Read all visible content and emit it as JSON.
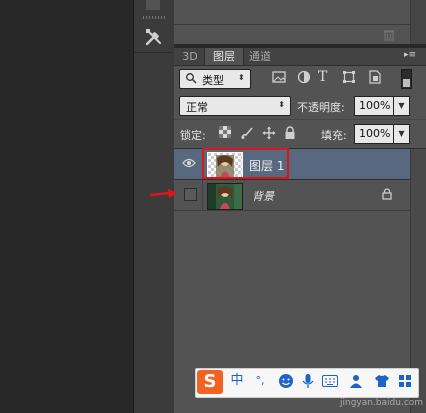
{
  "layers_panel": {
    "tabs": [
      "3D",
      "图层",
      "通道"
    ],
    "active_tab": "图层",
    "filter": {
      "label": "类型"
    },
    "blend_mode": "正常",
    "opacity": {
      "label": "不透明度:",
      "value": "100%"
    },
    "lock": {
      "label": "锁定:"
    },
    "fill": {
      "label": "填充:",
      "value": "100%"
    },
    "layers": [
      {
        "name": "图层 1",
        "visible": true,
        "selected": true
      },
      {
        "name": "背景",
        "visible": false,
        "selected": false,
        "locked": true
      }
    ]
  },
  "ime_toolbar": {
    "logo": "S",
    "mode": "中",
    "punct": "°,"
  },
  "watermark": "jingyan.baidu.com",
  "colors": {
    "highlight": "#e0151b",
    "selected_row": "#57687f",
    "ime_logo": "#f06322"
  },
  "icons": [
    "tools-icon",
    "trash-icon",
    "search-icon",
    "eye-icon",
    "lock-icon",
    "menu-icon"
  ]
}
